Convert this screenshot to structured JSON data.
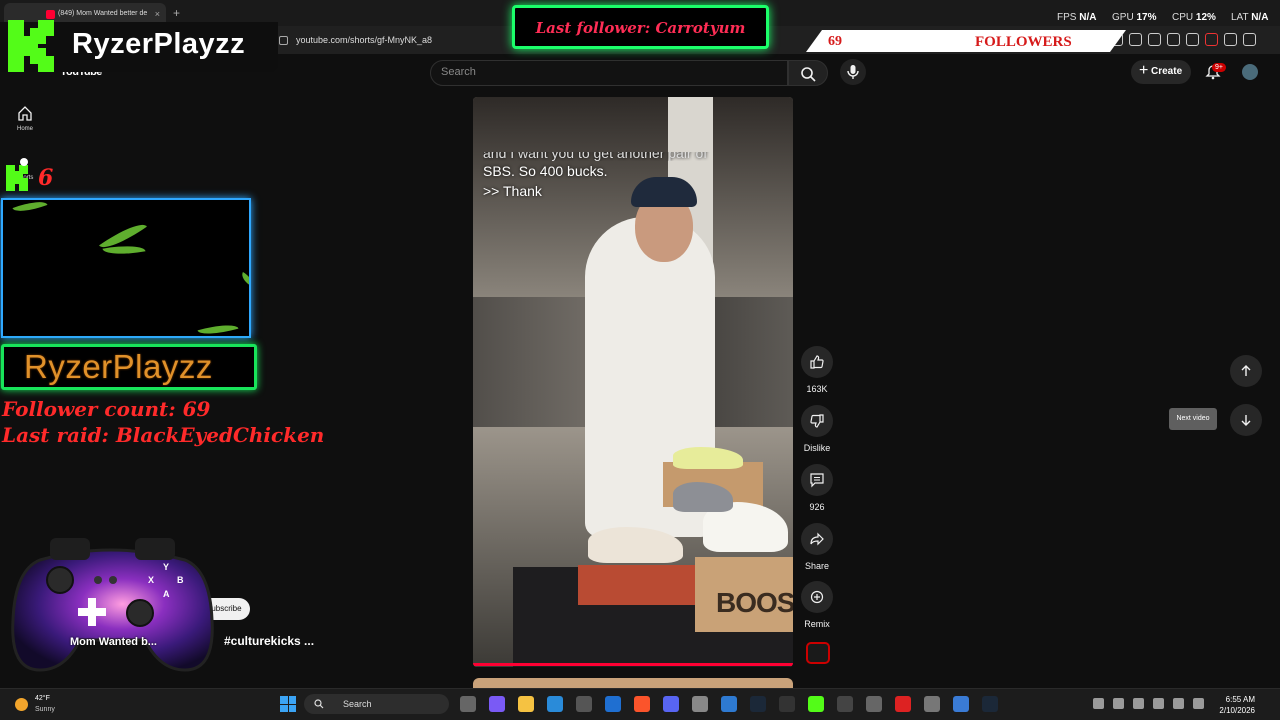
{
  "browser": {
    "tab_title": "(849) Mom Wanted better de",
    "url": "youtube.com/shorts/gf-MnyNK_a8",
    "perf": {
      "fps_label": "FPS",
      "fps_value": "N/A",
      "gpu_label": "GPU",
      "gpu_value": "17%",
      "cpu_label": "CPU",
      "cpu_value": "12%",
      "lat_label": "LAT",
      "lat_value": "N/A"
    }
  },
  "youtube": {
    "logo": "YouTube",
    "search_placeholder": "Search",
    "create_label": "Create",
    "notif_count": "9+",
    "nav": {
      "home": "Home",
      "shorts": "Shorts"
    },
    "video": {
      "caption_cut": "and I want you to get another pair of",
      "caption_line2": "SBS. So 400 bucks.",
      "caption_line3": ">> Thank",
      "box_text": "BOOS",
      "progress": 1.0
    },
    "actions": {
      "likes": "163K",
      "dislike": "Dislike",
      "comments": "926",
      "share": "Share",
      "remix": "Remix"
    },
    "tooltip": "Next video",
    "subscribe": "Subscribe",
    "channel_hashtag": "#culturekicks ...",
    "video_title_partial": "Mom Wanted b..."
  },
  "overlay": {
    "brand_name": "RyzerPlayzz",
    "last_follower": "Last follower: Carrotyum",
    "followers_count": "69",
    "followers_label": "FOLLOWERS",
    "kick_small_count": "6",
    "nameplate": "RyzerPlayzz",
    "follower_count_line": "Follower count: 69",
    "last_raid_line": "Last raid: BlackEyedChicken",
    "controller_buttons": {
      "y": "Y",
      "x": "X",
      "b": "B",
      "a": "A"
    }
  },
  "taskbar": {
    "weather_temp": "42°F",
    "weather_cond": "Sunny",
    "search_label": "Search",
    "time": "6:55 AM",
    "date": "2/10/2026"
  },
  "colors": {
    "yt_red": "#ff0033",
    "kick_green": "#53fc18",
    "overlay_red": "#ff2a2a",
    "neon_green": "#18e45a",
    "neon_blue": "#2fa8ff"
  }
}
